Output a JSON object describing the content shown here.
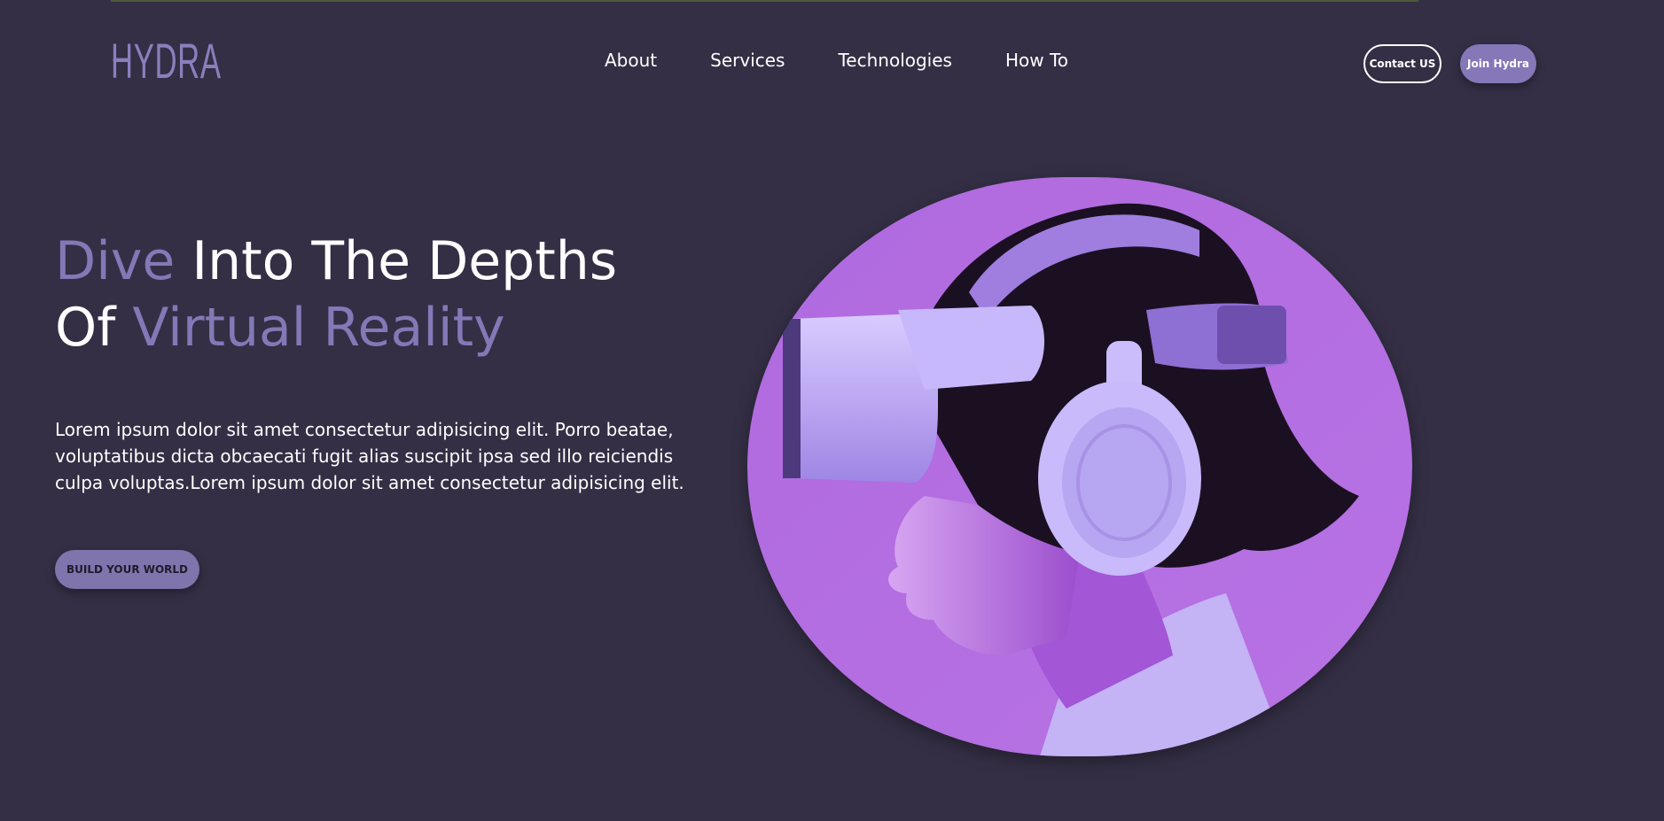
{
  "header": {
    "logo_text": "HYDRA",
    "nav": [
      "About",
      "Services",
      "Technologies",
      "How To"
    ],
    "contact_label": "Contact US",
    "join_label": "Join Hydra"
  },
  "hero": {
    "title_part1": "Dive",
    "title_part2": " Into The Depths",
    "title_part3": "Of ",
    "title_part4": "Virtual Reality",
    "description": "Lorem ipsum dolor sit amet consectetur adipisicing elit. Porro beatae, voluptatibus dicta obcaecati fugit alias suscipit ipsa sed illo reiciendis culpa voluptas.Lorem ipsum dolor sit amet consectetur adipisicing elit.",
    "cta_label": "BUILD YOUR WORLD"
  },
  "icons": {
    "logo": "hydra-swirl-icon"
  },
  "colors": {
    "background": "#342f45",
    "accent": "#8479b6",
    "button": "#8677b8",
    "image_bg": "#b36fe0"
  }
}
